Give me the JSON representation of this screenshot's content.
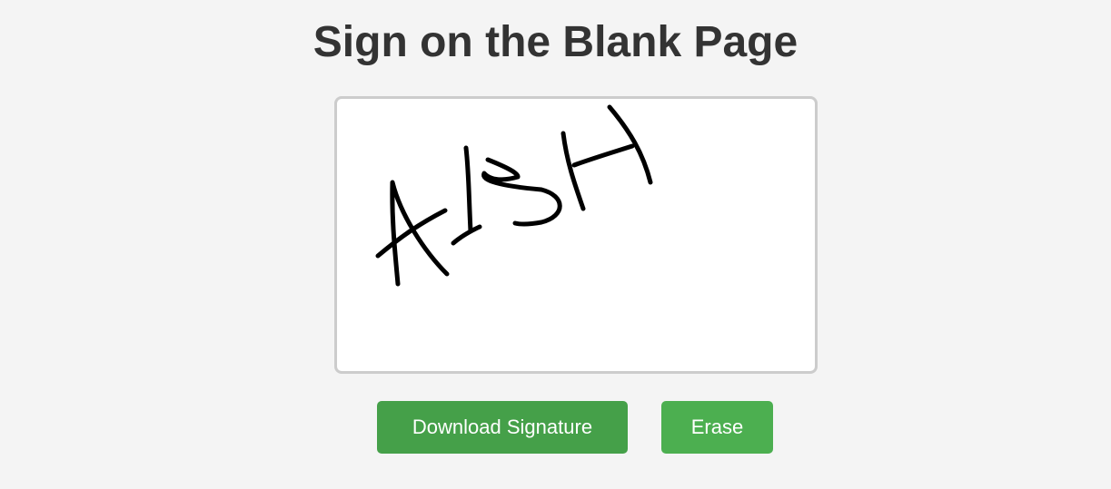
{
  "page": {
    "title": "Sign on the Blank Page"
  },
  "signature_pad": {
    "signature": "AISH",
    "ink_color": "#000000"
  },
  "actions": {
    "download_label": "Download Signature",
    "erase_label": "Erase"
  },
  "colors": {
    "background": "#f4f4f4",
    "title_text": "#333333",
    "pad_border": "#cccccc",
    "download_button": "#45a049",
    "erase_button": "#4caf50",
    "button_text": "#ffffff"
  }
}
